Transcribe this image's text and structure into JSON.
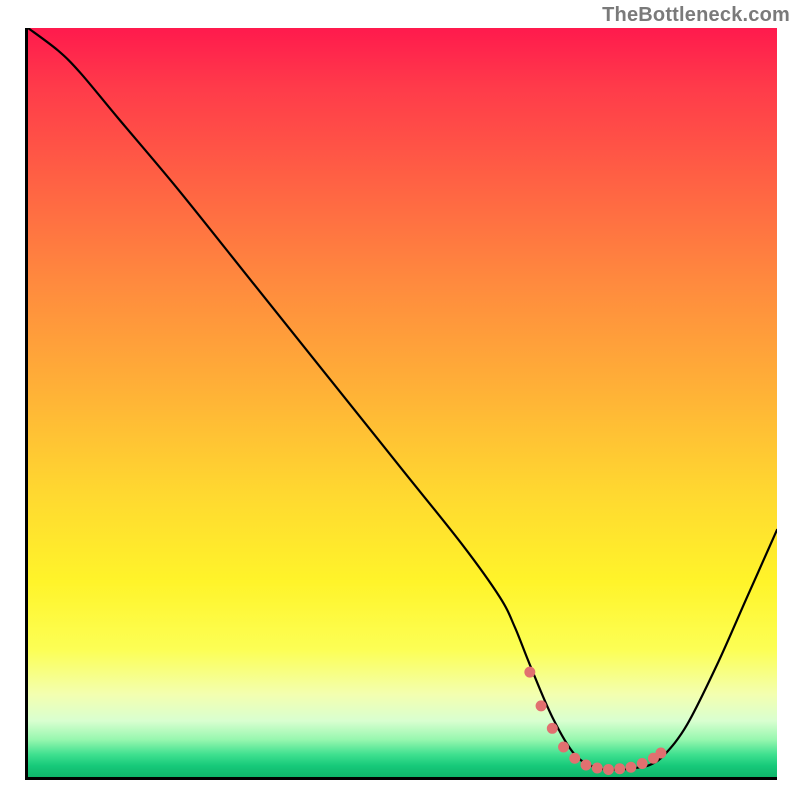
{
  "attribution": "TheBottleneck.com",
  "colors": {
    "dot_fill": "#e17070",
    "curve_stroke": "#000000"
  },
  "chart_data": {
    "type": "line",
    "title": "",
    "xlabel": "",
    "ylabel": "",
    "xlim": [
      0,
      100
    ],
    "ylim": [
      0,
      100
    ],
    "grid": false,
    "legend": false,
    "series": [
      {
        "name": "bottleneck-curve",
        "x": [
          0,
          4,
          7,
          12,
          20,
          30,
          40,
          50,
          58,
          63,
          65,
          67,
          70,
          73,
          76,
          79,
          81,
          83,
          85,
          88,
          92,
          96,
          100
        ],
        "y": [
          100,
          97,
          94,
          88,
          78.5,
          66,
          53.5,
          41,
          31,
          24,
          20,
          15,
          8,
          3,
          1.2,
          1.0,
          1.2,
          1.6,
          3,
          7,
          15,
          24,
          33
        ]
      }
    ],
    "optimal_dots": {
      "name": "optimal-range",
      "x": [
        67,
        68.5,
        70,
        71.5,
        73,
        74.5,
        76,
        77.5,
        79,
        80.5,
        82,
        83.5,
        84.5
      ],
      "y": [
        14,
        9.5,
        6.5,
        4,
        2.5,
        1.6,
        1.2,
        1.0,
        1.1,
        1.3,
        1.8,
        2.5,
        3.2
      ]
    }
  }
}
